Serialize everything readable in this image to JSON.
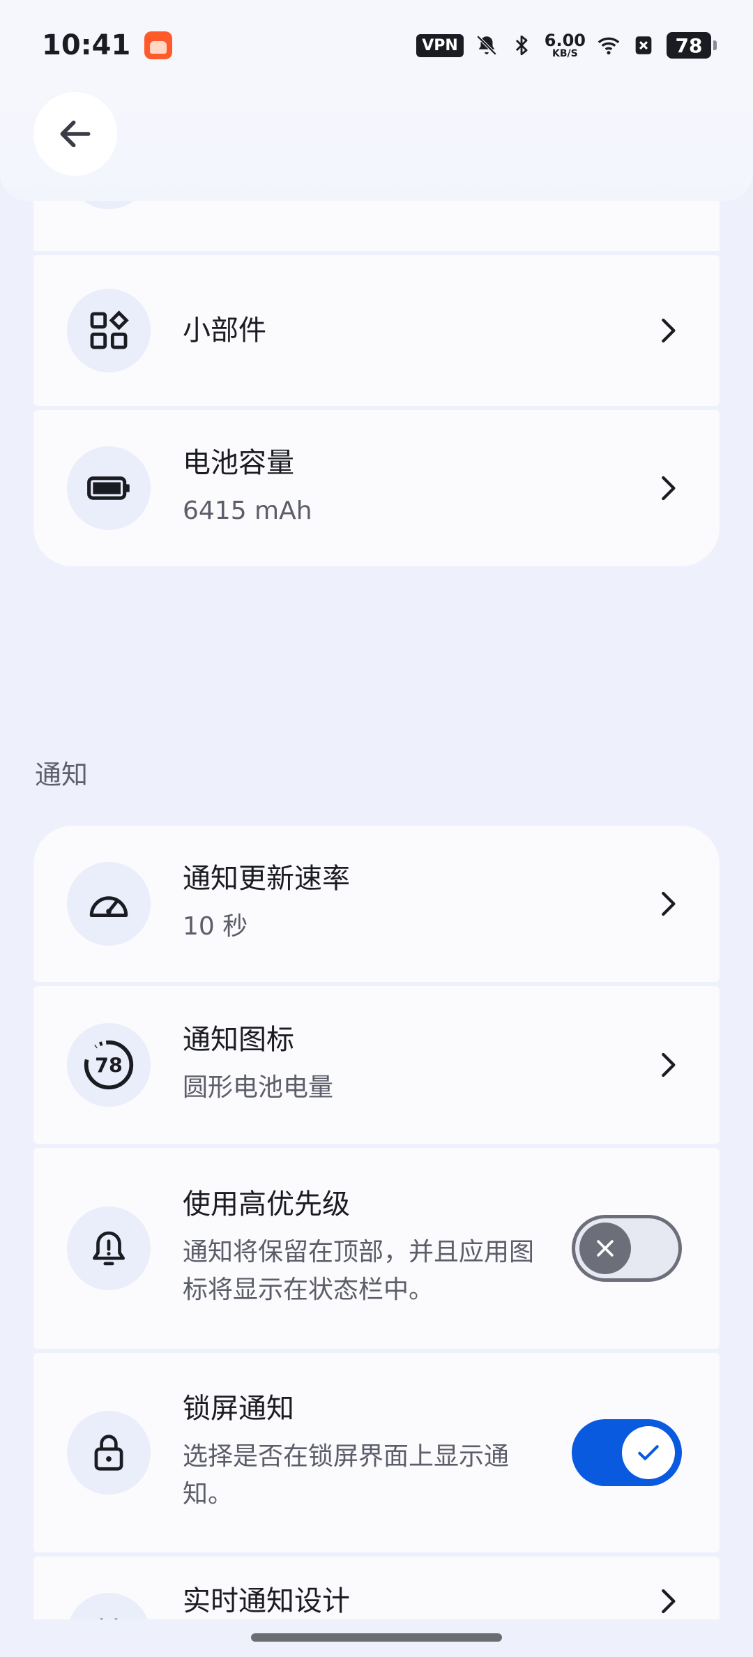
{
  "status_bar": {
    "time": "10:41",
    "vpn": "VPN",
    "speed_value": "6.00",
    "speed_unit": "KB/S",
    "battery": "78",
    "icons": [
      "notification-app-icon",
      "vpn-icon",
      "mute-bell-icon",
      "bluetooth-icon",
      "wifi-icon",
      "x-app-icon",
      "battery-icon"
    ]
  },
  "header": {
    "back_icon": "arrow-left-icon"
  },
  "settings_top": [
    {
      "icon": "widgets-icon",
      "title": "小部件",
      "subtitle": ""
    },
    {
      "icon": "battery-icon",
      "title": "电池容量",
      "subtitle": "6415 mAh"
    }
  ],
  "notification_section": {
    "label": "通知",
    "items": [
      {
        "icon": "speedometer-icon",
        "title": "通知更新速率",
        "subtitle": "10 秒",
        "control": "chevron"
      },
      {
        "icon": "circular-battery-icon",
        "icon_text": "78",
        "title": "通知图标",
        "subtitle": "圆形电池电量",
        "control": "chevron"
      },
      {
        "icon": "bell-icon",
        "title": "使用高优先级",
        "subtitle": "通知将保留在顶部，并且应用图标将显示在状态栏中。",
        "control": "toggle",
        "enabled": false
      },
      {
        "icon": "lock-icon",
        "title": "锁屏通知",
        "subtitle": "选择是否在锁屏界面上显示通知。",
        "control": "toggle",
        "enabled": true
      },
      {
        "icon": "live-notification-icon",
        "title": "实时通知设计",
        "subtitle": "",
        "control": "chevron"
      }
    ]
  },
  "colors": {
    "background": "#eef1fc",
    "card": "#fbfbfe",
    "icon_bg": "#eaedfa",
    "toggle_on": "#0a5ae0",
    "toggle_off": "#6c6e79"
  }
}
